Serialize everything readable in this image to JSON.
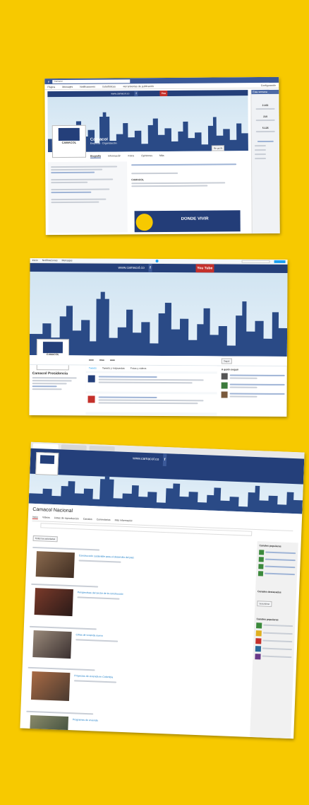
{
  "facebook": {
    "search_placeholder": "Camacol",
    "nav_items": [
      "Página",
      "Mensajes",
      "Notificaciones",
      "Estadísticas",
      "Herramientas de publicación"
    ],
    "nav_right": "Configuración",
    "header_site": "www.camacol.co",
    "page_name": "Camacol",
    "page_sub": "Empresa · Organización",
    "tabs": [
      "Biografía",
      "Información",
      "Fotos",
      "Opiniones",
      "Más"
    ],
    "post_title": "CAMACOL",
    "post_headline": "DONDE VIVIR",
    "sidebar_title": "Esta semana",
    "sidebar_values": [
      "2.163",
      "210",
      "5.126"
    ]
  },
  "twitter": {
    "header_site": "www.camacol.co",
    "youtube_label": "You Tube",
    "profile_name": "Camacol Presidencia",
    "tabs": [
      "Tweets",
      "Tweets y respuestas",
      "Fotos y videos"
    ],
    "follow_label": "Seguir",
    "who_to_follow": "A quién seguir"
  },
  "youtube": {
    "header_site": "www.camacol.co",
    "channel_name": "Camacol Nacional",
    "tabs": [
      "Inicio",
      "Videos",
      "Listas de reproducción",
      "Canales",
      "Comentarios",
      "Más información"
    ],
    "filter_label": "Todas las actividades",
    "videos": [
      {
        "title": "Construcción sostenible para el desarrollo del país"
      },
      {
        "title": "Perspectivas del sector de la construcción"
      },
      {
        "title": "Cifras de vivienda nueva"
      },
      {
        "title": "Proyectos de vivienda en Colombia"
      },
      {
        "title": "Programas de vivienda"
      }
    ],
    "side_titles": [
      "Canales populares",
      "Canales destacados",
      "Canales populares"
    ]
  },
  "colors": {
    "background": "#f7c900",
    "brand_blue": "#243f7a",
    "facebook_blue": "#3b5998",
    "youtube_red": "#c4302b"
  }
}
